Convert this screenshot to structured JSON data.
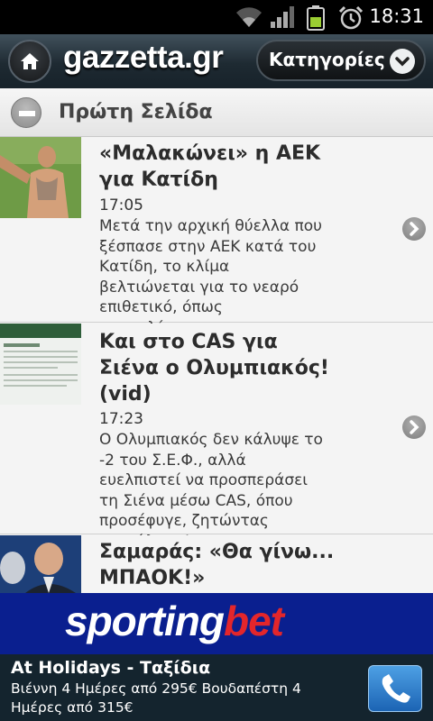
{
  "status_bar": {
    "time": "18:31",
    "icons": [
      "wifi-icon",
      "signal-icon",
      "battery-icon",
      "alarm-icon"
    ]
  },
  "header": {
    "logo": "gazzetta.gr",
    "categories_label": "Κατηγορίες"
  },
  "section": {
    "title": "Πρώτη Σελίδα"
  },
  "articles": [
    {
      "headline": "«Μαλακώνει» η ΑΕΚ για Κατίδη",
      "time": "17:05",
      "summary": "  Μετά την αρχική θύελλα που ξέσπασε στην ΑΕΚ κατά του Κατίδη, το κλίμα βελτιώνεται για το νεαρό επιθετικό, όπως αποκαλύπτει..."
    },
    {
      "headline": "Και στο CAS για Σιένα ο Ολυμπιακός! (vid)",
      "time": "17:23",
      "summary": "Ο Ολυμπιακός δεν κάλυψε το -2 του Σ.Ε.Φ., αλλά ευελπιστεί να προσπεράσει τη Σιένα μέσω CAS, όπου προσέφυγε, ζητώντας επανάληψη!..."
    },
    {
      "headline": "Σαμαράς: «Θα γίνω... ΜΠΑΟΚ!»",
      "time": "",
      "summary": ""
    }
  ],
  "ad": {
    "brand_part1": "sporting",
    "brand_part2": "bet",
    "title": "At Holidays - Ταξίδια",
    "text": "Βιέννη 4 Ημέρες από 295€ Βουδαπέστη 4 Ημέρες από 315€"
  },
  "colors": {
    "brand_red": "#e3262b",
    "ad_blue": "#0a1f8f",
    "header_dark": "#1e2a32"
  }
}
